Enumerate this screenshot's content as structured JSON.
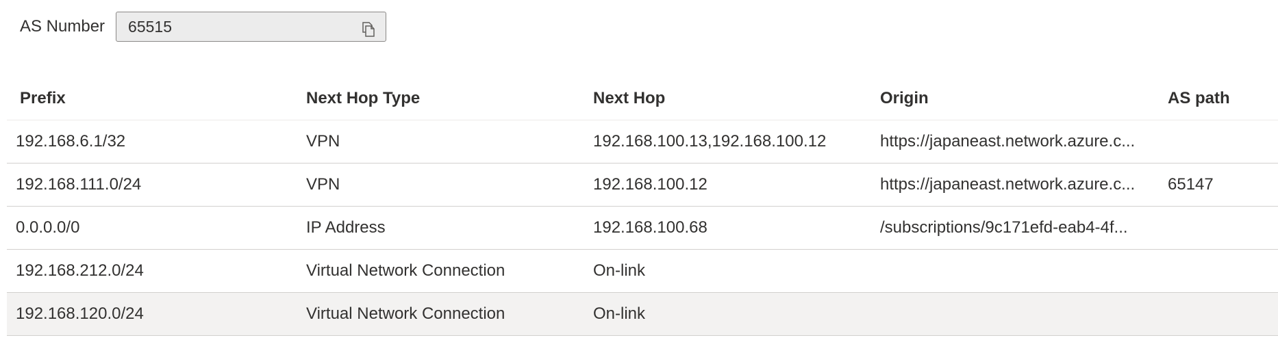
{
  "as_number": {
    "label": "AS Number",
    "value": "65515",
    "copy_icon": "copy-icon"
  },
  "table": {
    "columns": [
      "Prefix",
      "Next Hop Type",
      "Next Hop",
      "Origin",
      "AS path"
    ],
    "rows": [
      {
        "prefix": "192.168.6.1/32",
        "next_hop_type": "VPN",
        "next_hop": "192.168.100.13,192.168.100.12",
        "origin": "https://japaneast.network.azure.c...",
        "as_path": ""
      },
      {
        "prefix": "192.168.111.0/24",
        "next_hop_type": "VPN",
        "next_hop": "192.168.100.12",
        "origin": "https://japaneast.network.azure.c...",
        "as_path": "65147"
      },
      {
        "prefix": "0.0.0.0/0",
        "next_hop_type": "IP Address",
        "next_hop": "192.168.100.68",
        "origin": "/subscriptions/9c171efd-eab4-4f...",
        "as_path": ""
      },
      {
        "prefix": "192.168.212.0/24",
        "next_hop_type": "Virtual Network Connection",
        "next_hop": "On-link",
        "origin": "",
        "as_path": ""
      },
      {
        "prefix": "192.168.120.0/24",
        "next_hop_type": "Virtual Network Connection",
        "next_hop": "On-link",
        "origin": "",
        "as_path": ""
      }
    ],
    "selected_row_index": 4,
    "selected_row_bg": "#f3f2f1"
  }
}
